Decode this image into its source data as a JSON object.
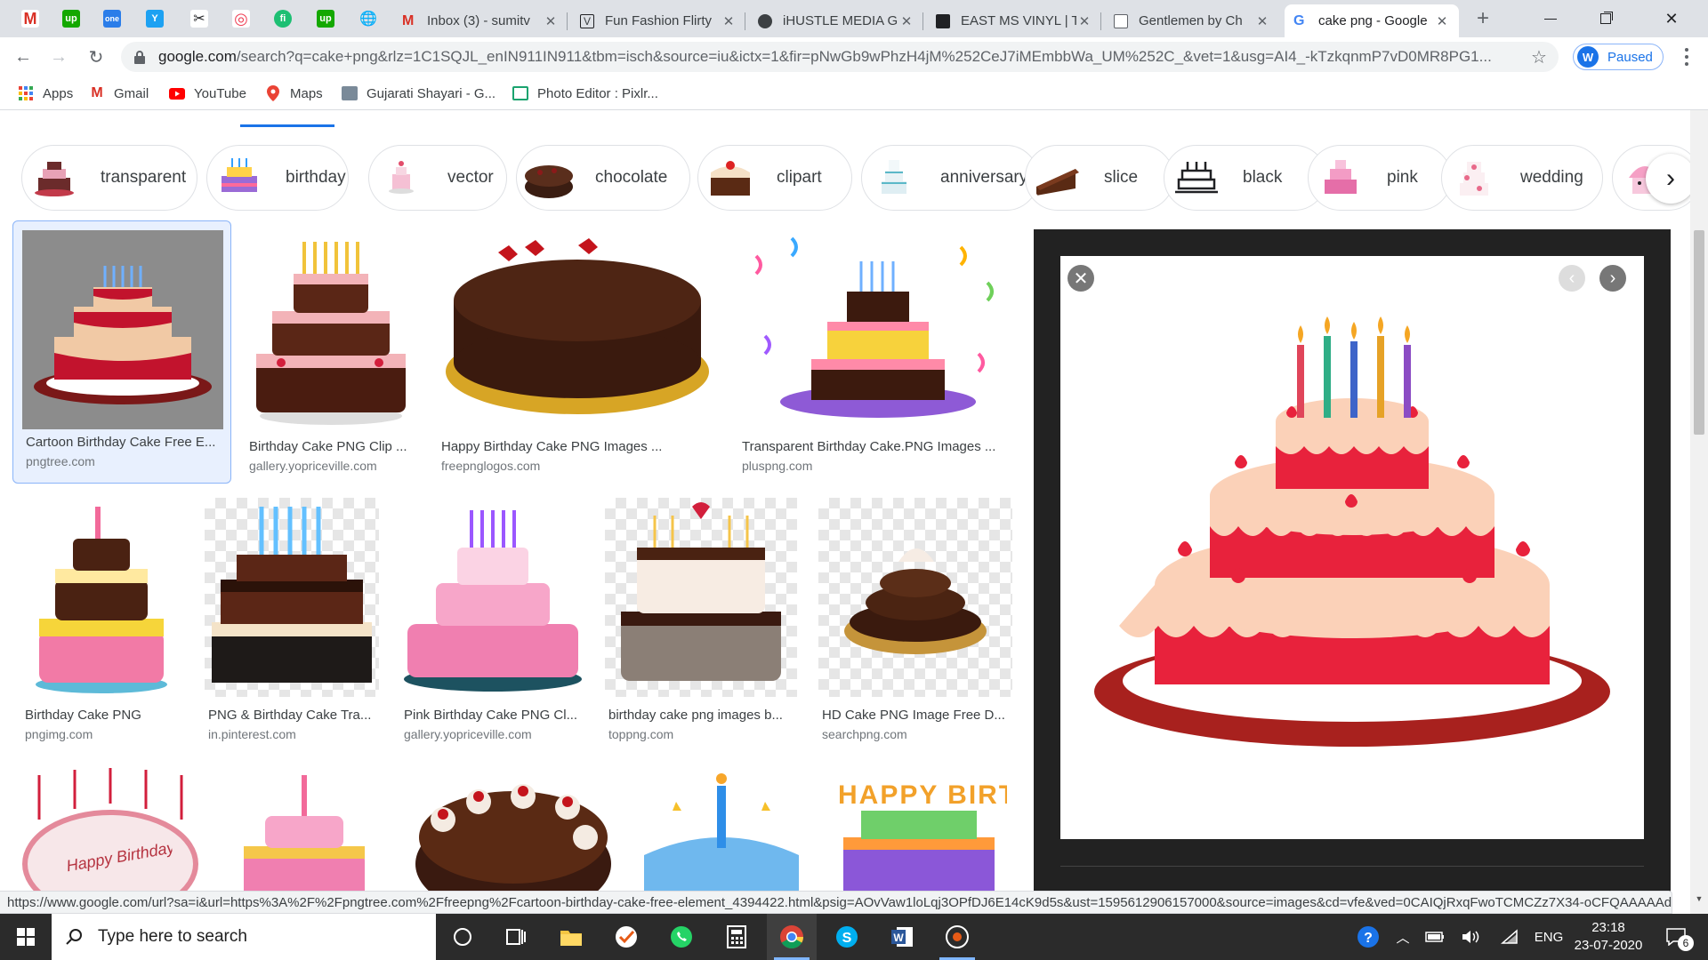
{
  "browser": {
    "pinned_tabs": [
      {
        "icon": "gmail-icon",
        "glyph": "M",
        "color": "#d93025"
      },
      {
        "icon": "upwork-icon",
        "glyph": "up",
        "color": "#14a800"
      },
      {
        "icon": "onedrive-icon",
        "glyph": "one",
        "color": "#2b7de9"
      },
      {
        "icon": "twitter-y-icon",
        "glyph": "Y",
        "color": "#1da1f2"
      },
      {
        "icon": "tools-icon",
        "glyph": "✂",
        "color": "#5f6368"
      },
      {
        "icon": "pocket-icon",
        "glyph": "◎",
        "color": "#ef4056"
      },
      {
        "icon": "fiverr-icon",
        "glyph": "fi",
        "color": "#1dbf73"
      },
      {
        "icon": "upwork-icon",
        "glyph": "up",
        "color": "#14a800"
      },
      {
        "icon": "globe-icon",
        "glyph": "🌐",
        "color": "#5f6368"
      }
    ],
    "tabs": [
      {
        "title": "Inbox (3) - sumitv",
        "icon": "gmail-icon"
      },
      {
        "title": "Fun Fashion Flirty",
        "icon": "fashion-icon"
      },
      {
        "title": "iHUSTLE MEDIA G",
        "icon": "ihustle-icon"
      },
      {
        "title": "EAST MS VINYL | T",
        "icon": "vinyl-icon"
      },
      {
        "title": "Gentlemen by Ch",
        "icon": "page-icon"
      },
      {
        "title": "cake png - Google",
        "icon": "google-icon"
      }
    ],
    "url_host": "google.com",
    "url_rest": "/search?q=cake+png&rlz=1C1SQJL_enIN911IN911&tbm=isch&source=iu&ictx=1&fir=pNwGb9wPhzH4jM%252CeJ7iMEmbbWa_UM%252C_&vet=1&usg=AI4_-kTzkqnmP7vD0MR8PG1...",
    "profile_status": "Paused",
    "bookmarks": [
      {
        "label": "Apps",
        "icon": "apps-grid-icon"
      },
      {
        "label": "Gmail",
        "icon": "gmail-icon"
      },
      {
        "label": "YouTube",
        "icon": "youtube-icon"
      },
      {
        "label": "Maps",
        "icon": "maps-pin-icon"
      },
      {
        "label": "Gujarati Shayari - G...",
        "icon": "shayari-icon"
      },
      {
        "label": "Photo Editor : Pixlr...",
        "icon": "pixlr-icon"
      }
    ]
  },
  "chips": [
    {
      "label": "transparent"
    },
    {
      "label": "birthday"
    },
    {
      "label": "vector"
    },
    {
      "label": "chocolate"
    },
    {
      "label": "clipart"
    },
    {
      "label": "anniversary"
    },
    {
      "label": "slice"
    },
    {
      "label": "black"
    },
    {
      "label": "pink"
    },
    {
      "label": "wedding"
    }
  ],
  "results": [
    {
      "title": "Cartoon Birthday Cake Free E...",
      "source": "pngtree.com"
    },
    {
      "title": "Birthday Cake PNG Clip ...",
      "source": "gallery.yopriceville.com"
    },
    {
      "title": "Happy Birthday Cake PNG Images ...",
      "source": "freepnglogos.com"
    },
    {
      "title": "Transparent Birthday Cake.PNG Images ...",
      "source": "pluspng.com"
    },
    {
      "title": "Birthday Cake PNG",
      "source": "pngimg.com"
    },
    {
      "title": "PNG & Birthday Cake Tra...",
      "source": "in.pinterest.com"
    },
    {
      "title": "Pink Birthday Cake PNG Cl...",
      "source": "gallery.yopriceville.com"
    },
    {
      "title": "birthday cake png images b...",
      "source": "toppng.com"
    },
    {
      "title": "HD Cake PNG Image Free D...",
      "source": "searchpng.com"
    },
    {
      "title": "Happy Birthday",
      "source": ""
    },
    {
      "title": "",
      "source": ""
    },
    {
      "title": "",
      "source": ""
    },
    {
      "title": "",
      "source": ""
    },
    {
      "title": "HAPPY BIRTHDAY",
      "source": ""
    }
  ],
  "status_url": "https://www.google.com/url?sa=i&url=https%3A%2F%2Fpngtree.com%2Ffreepng%2Fcartoon-birthday-cake-free-element_4394422.html&psig=AOvVaw1loLqj3OPfDJ6E14cK9d5s&ust=1595612906157000&source=images&cd=vfe&ved=0CAIQjRxqFwoTCMCZz7X34-oCFQAAAAAd...",
  "taskbar": {
    "search_placeholder": "Type here to search",
    "language": "ENG",
    "time": "23:18",
    "date": "23-07-2020",
    "notification_count": "6"
  },
  "colors": {
    "accent": "#1a73e8",
    "taskbar": "#2b2b2b",
    "preview_bg": "#222222"
  }
}
